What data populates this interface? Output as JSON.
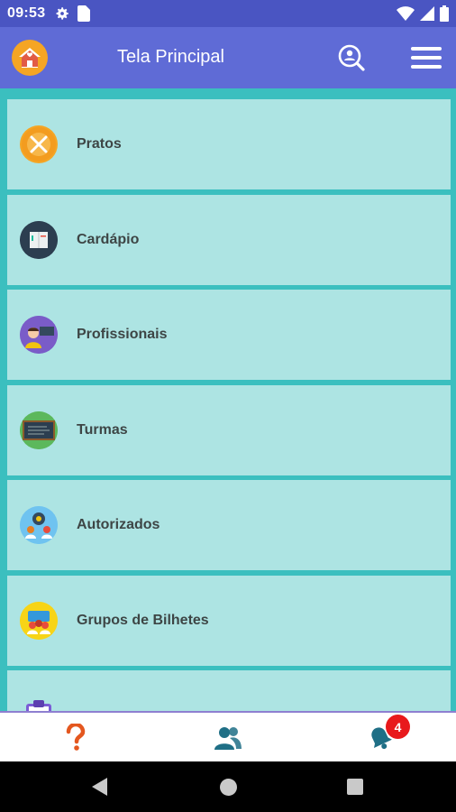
{
  "status_bar": {
    "time": "09:53",
    "left_icons": [
      "gear-icon",
      "sim-card-icon"
    ],
    "right_icons": [
      "wifi-icon",
      "signal-icon",
      "battery-icon"
    ]
  },
  "app_bar": {
    "title": "Tela Principal",
    "home_icon": "school-house-icon",
    "search_icon": "search-person-icon",
    "menu_icon": "hamburger-menu-icon"
  },
  "menu": {
    "items": [
      {
        "label": "Pratos",
        "icon": "fork-knife-icon",
        "color": "#f5a524"
      },
      {
        "label": "Cardápio",
        "icon": "book-menu-icon",
        "color": "#2c3e50"
      },
      {
        "label": "Profissionais",
        "icon": "teacher-icon",
        "color": "#7a5cc8"
      },
      {
        "label": "Turmas",
        "icon": "chalkboard-icon",
        "color": "#5cb85c"
      },
      {
        "label": "Autorizados",
        "icon": "authorized-people-icon",
        "color": "#6fc3f0"
      },
      {
        "label": "Grupos de Bilhetes",
        "icon": "group-notes-icon",
        "color": "#f7d417"
      },
      {
        "label": "",
        "icon": "clipboard-icon",
        "color": "#7b5cd6"
      }
    ]
  },
  "bottom_bar": {
    "help_icon": "question-mark-icon",
    "people_icon": "users-icon",
    "notifications_icon": "bell-icon",
    "badge_count": "4"
  },
  "colors": {
    "status_bar": "#4a55c2",
    "app_bar": "#5f6bd6",
    "content_bg": "#3bbfbf",
    "card_bg": "#ade4e3",
    "badge": "#e8191c"
  }
}
